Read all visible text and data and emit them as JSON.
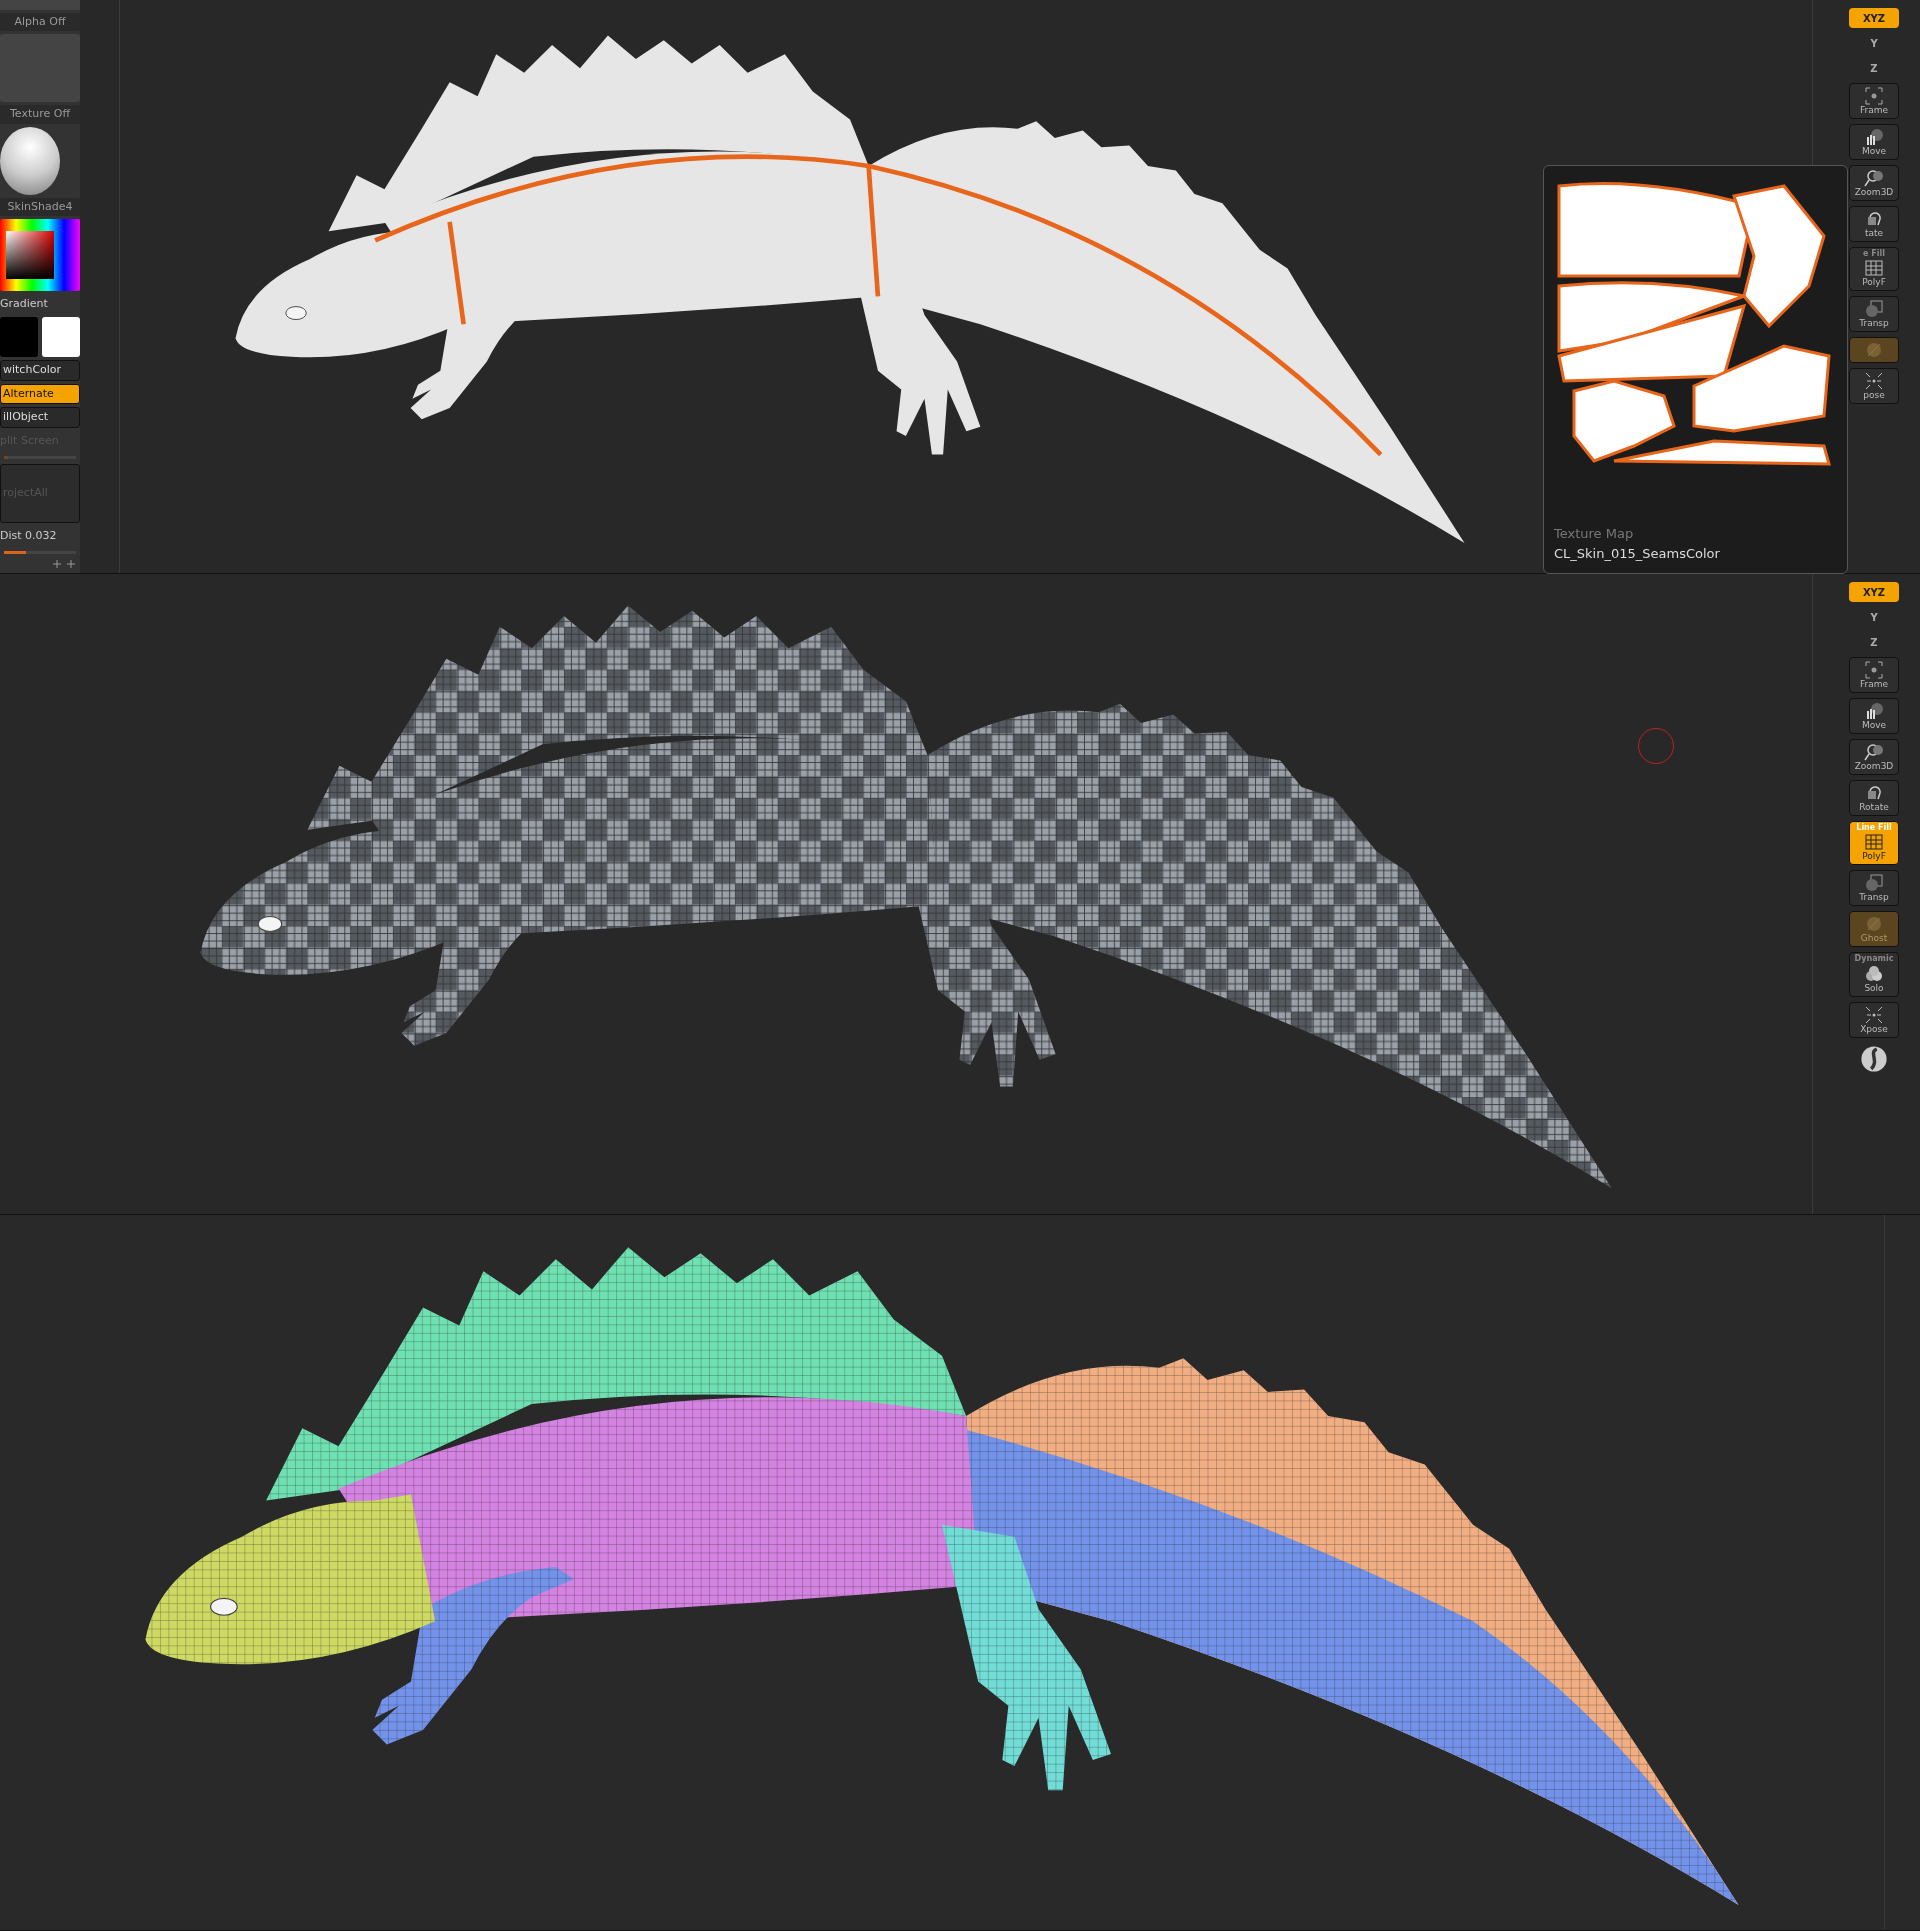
{
  "panels": [
    {
      "kind": "seams",
      "left_panel": {
        "items": [
          {
            "kind": "alpha",
            "label": "Alpha Off"
          },
          {
            "kind": "texture",
            "label": "Texture Off"
          },
          {
            "kind": "material",
            "label": "SkinShade4"
          },
          {
            "kind": "picker"
          },
          {
            "kind": "label",
            "label": "Gradient"
          },
          {
            "kind": "swatches"
          },
          {
            "kind": "button",
            "label": "witchColor",
            "selected": false,
            "disabled": false
          },
          {
            "kind": "button",
            "label": "Alternate",
            "selected": true,
            "disabled": false
          },
          {
            "kind": "button",
            "label": "illObject",
            "selected": false,
            "disabled": false
          },
          {
            "kind": "slider",
            "label": "plit Screen",
            "value": "",
            "level": 0.05,
            "disabled": true
          },
          {
            "kind": "tall",
            "label": "rojectAll",
            "selected": false,
            "disabled": true
          },
          {
            "kind": "slider",
            "label": "Dist",
            "value": "0.032",
            "level": 0.3,
            "disabled": false
          },
          {
            "kind": "icons"
          }
        ]
      },
      "toolbar": [
        {
          "kind": "axis",
          "label": "XYZ",
          "selected": true
        },
        {
          "kind": "axis",
          "label": "Y",
          "selected": false
        },
        {
          "kind": "axis",
          "label": "Z",
          "selected": false
        },
        {
          "kind": "frame",
          "label": "Frame",
          "selected": false
        },
        {
          "kind": "move",
          "label": "Move",
          "selected": false
        },
        {
          "kind": "zoom",
          "label": "Zoom3D",
          "selected": false
        },
        {
          "kind": "rotate",
          "label": "tate",
          "selected": false
        },
        {
          "kind": "polyf",
          "caption": "e Fill",
          "label": "PolyF",
          "selected": false
        },
        {
          "kind": "transp",
          "label": "Transp",
          "selected": false
        },
        {
          "kind": "ghost",
          "disabled": true
        },
        {
          "kind": "xpose",
          "label": "pose",
          "selected": false
        }
      ],
      "texture_popup": {
        "title": "Texture Map",
        "name": "CL_Skin_015_SeamsColor"
      }
    },
    {
      "kind": "checker",
      "toolbar": [
        {
          "kind": "axis",
          "label": "XYZ",
          "selected": true
        },
        {
          "kind": "axis",
          "label": "Y",
          "selected": false
        },
        {
          "kind": "axis",
          "label": "Z",
          "selected": false
        },
        {
          "kind": "frame",
          "label": "Frame",
          "selected": false
        },
        {
          "kind": "move",
          "label": "Move",
          "selected": false
        },
        {
          "kind": "zoom",
          "label": "Zoom3D",
          "selected": false
        },
        {
          "kind": "rotate",
          "label": "Rotate",
          "selected": false
        },
        {
          "kind": "polyf",
          "caption": "Line Fill",
          "label": "PolyF",
          "selected": true
        },
        {
          "kind": "transp",
          "label": "Transp",
          "selected": false
        },
        {
          "kind": "ghost",
          "label": "Ghost",
          "disabled": true
        },
        {
          "kind": "solo",
          "caption": "Dynamic",
          "label": "Solo",
          "selected": false
        },
        {
          "kind": "xpose",
          "label": "Xpose",
          "selected": false
        },
        {
          "kind": "sphere"
        }
      ],
      "cursor": true
    },
    {
      "kind": "polygroups"
    }
  ]
}
